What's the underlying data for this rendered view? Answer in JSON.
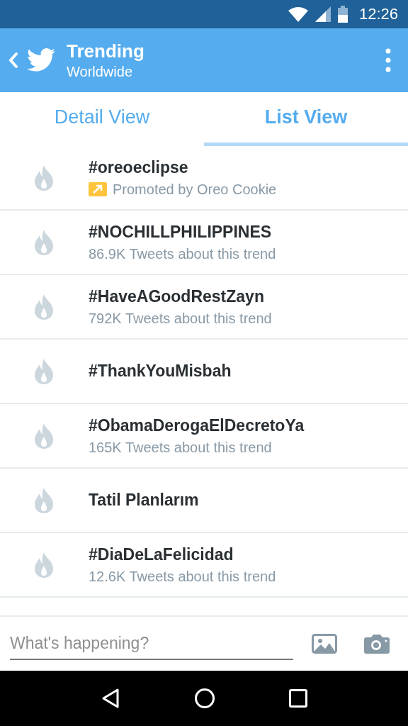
{
  "status_bar": {
    "time": "12:26"
  },
  "header": {
    "title": "Trending",
    "subtitle": "Worldwide"
  },
  "tabs": [
    {
      "label": "Detail View",
      "selected": false
    },
    {
      "label": "List View",
      "selected": true
    }
  ],
  "trends": [
    {
      "kind": "promoted",
      "name": "#oreoeclipse",
      "detail": "Promoted by Oreo Cookie"
    },
    {
      "kind": "trend",
      "name": "#NOCHILLPHILIPPINES",
      "detail": "86.9K Tweets about this trend"
    },
    {
      "kind": "trend",
      "name": "#HaveAGoodRestZayn",
      "detail": "792K Tweets about this trend"
    },
    {
      "kind": "trend",
      "name": "#ThankYouMisbah"
    },
    {
      "kind": "trend",
      "name": "#ObamaDerogaElDecretoYa",
      "detail": "165K Tweets about this trend"
    },
    {
      "kind": "trend",
      "name": "Tatil Planlarım"
    },
    {
      "kind": "trend",
      "name": "#DiaDeLaFelicidad",
      "detail": "12.6K Tweets about this trend"
    }
  ],
  "compose": {
    "placeholder": "What's happening?"
  }
}
